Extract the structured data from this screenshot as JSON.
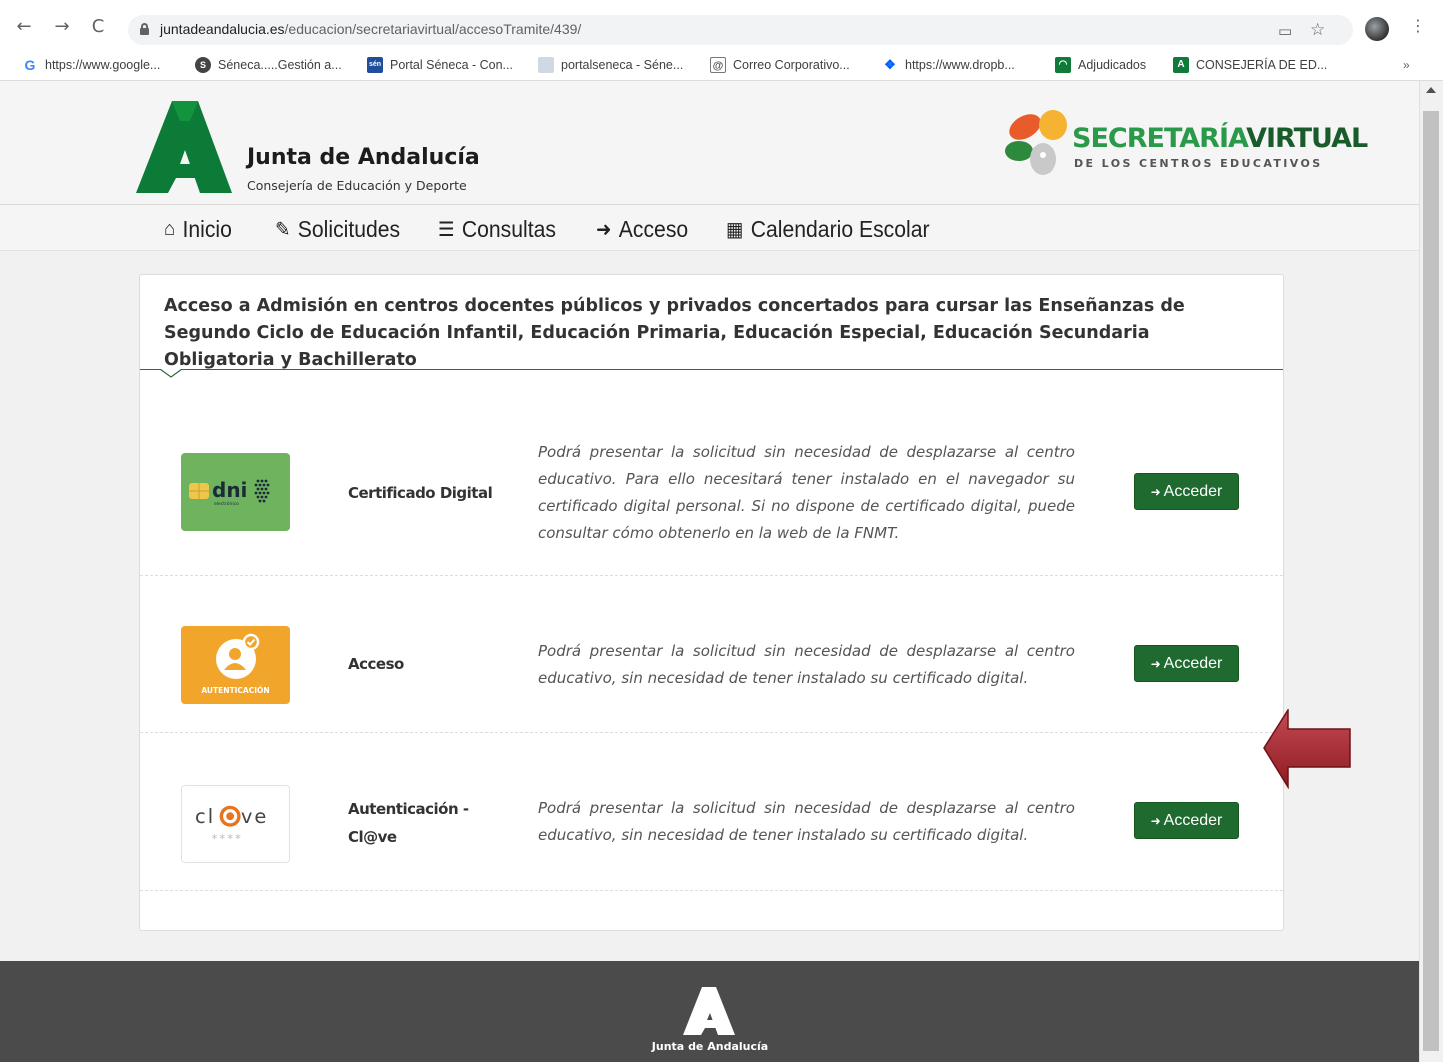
{
  "browser": {
    "url_domain": "juntadeandalucia.es",
    "url_path": "/educacion/secretariavirtual/accesoTramite/439/",
    "bookmarks": [
      {
        "label": "https://www.google...",
        "icon": "google-icon"
      },
      {
        "label": "Séneca.....Gestión a...",
        "icon": "seneca-icon"
      },
      {
        "label": "Portal Séneca - Con...",
        "icon": "sen-icon"
      },
      {
        "label": "portalseneca - Séne...",
        "icon": "portal-icon"
      },
      {
        "label": "Correo Corporativo...",
        "icon": "at-icon"
      },
      {
        "label": "https://www.dropb...",
        "icon": "dropbox-icon"
      },
      {
        "label": "Adjudicados",
        "icon": "adjudicados-icon"
      },
      {
        "label": "CONSEJERÍA DE ED...",
        "icon": "consejeria-icon"
      }
    ],
    "more": "»"
  },
  "header": {
    "title": "Junta de Andalucía",
    "subtitle": "Consejería de Educación y Deporte",
    "sv_title_a": "SECRETARÍA",
    "sv_title_b": "VIRTUAL",
    "sv_subtitle": "DE LOS CENTROS EDUCATIVOS"
  },
  "menu": {
    "items": [
      {
        "label": "Inicio",
        "icon": "home-icon"
      },
      {
        "label": "Solicitudes",
        "icon": "pencil-icon"
      },
      {
        "label": "Consultas",
        "icon": "list-icon"
      },
      {
        "label": "Acceso",
        "icon": "sign-in-icon"
      },
      {
        "label": "Calendario Escolar",
        "icon": "calendar-icon"
      }
    ]
  },
  "main": {
    "title": "Acceso a Admisión en centros docentes públicos y privados concertados para cursar las Enseñanzas de Segundo Ciclo de Educación Infantil, Educación Primaria, Educación Especial, Educación Secundaria Obligatoria y Bachillerato",
    "options": [
      {
        "label": "Certificado Digital",
        "icon_text": "dni",
        "icon_small": "electrónico",
        "description": "Podrá presentar la solicitud sin necesidad de desplazarse al centro educativo. Para ello necesitará tener instalado en el navegador su certificado digital personal. Si no dispone de certificado digital, puede consultar cómo obtenerlo en la web de la FNMT.",
        "button": "Acceder"
      },
      {
        "label": "Acceso",
        "icon_text": "AUTENTICACIÓN",
        "description": "Podrá presentar la solicitud sin necesidad de desplazarse al centro educativo, sin necesidad de tener instalado su certificado digital.",
        "button": "Acceder"
      },
      {
        "label": "Autenticación - Cl@ve",
        "icon_text_a": "cl",
        "icon_text_b": "ve",
        "icon_stars": "****",
        "description": "Podrá presentar la solicitud sin necesidad de desplazarse al centro educativo, sin necesidad de tener instalado su certificado digital.",
        "button": "Acceder"
      }
    ]
  },
  "footer": {
    "text": "Junta de Andalucía"
  },
  "colors": {
    "primary_green": "#1e6a2f",
    "brand_green": "#2a9a4a",
    "footer": "#4b4b4b",
    "arrow": "#a8232a"
  }
}
